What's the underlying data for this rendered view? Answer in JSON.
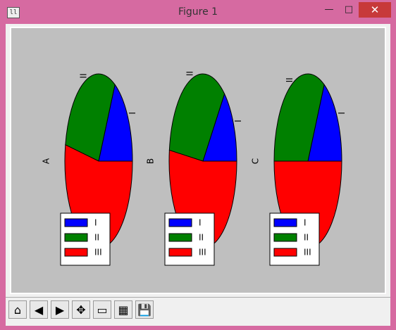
{
  "window": {
    "title": "Figure 1",
    "app_icon": "matplotlib-icon",
    "controls": {
      "minimize": "—",
      "maximize": "□",
      "close": "✕"
    }
  },
  "chart_data": [
    {
      "type": "pie",
      "ylabel": "A",
      "categories": [
        "I",
        "II",
        "III"
      ],
      "values": [
        17,
        30,
        53
      ],
      "colors": [
        "#0000ff",
        "#008000",
        "#ff0000"
      ],
      "legend": "lower-center"
    },
    {
      "type": "pie",
      "ylabel": "B",
      "categories": [
        "I",
        "II",
        "III"
      ],
      "values": [
        14,
        34,
        52
      ],
      "colors": [
        "#0000ff",
        "#008000",
        "#ff0000"
      ],
      "legend": "lower-center"
    },
    {
      "type": "pie",
      "ylabel": "C",
      "categories": [
        "I",
        "II",
        "III"
      ],
      "values": [
        17,
        33,
        50
      ],
      "colors": [
        "#0000ff",
        "#008000",
        "#ff0000"
      ],
      "legend": "lower-center"
    }
  ],
  "toolbar": {
    "buttons": [
      {
        "name": "home-icon",
        "glyph": "⌂"
      },
      {
        "name": "back-icon",
        "glyph": "◀"
      },
      {
        "name": "forward-icon",
        "glyph": "▶"
      },
      {
        "name": "pan-icon",
        "glyph": "✥"
      },
      {
        "name": "zoom-icon",
        "glyph": "▭"
      },
      {
        "name": "subplots-icon",
        "glyph": "▦"
      },
      {
        "name": "save-icon",
        "glyph": "💾"
      }
    ]
  }
}
